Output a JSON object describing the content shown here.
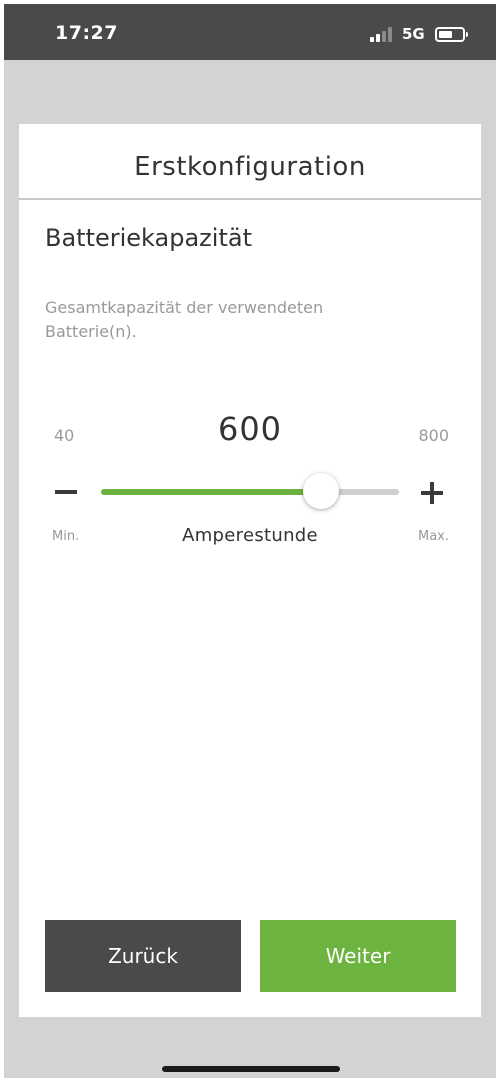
{
  "status_bar": {
    "time": "17:27",
    "network": "5G",
    "icons": [
      "signal-icon",
      "battery-icon"
    ]
  },
  "dialog": {
    "title": "Erstkonfiguration",
    "section_title": "Batteriekapazität",
    "description": "Gesamtkapazität der verwendeten Batterie(n).",
    "slider": {
      "min": "40",
      "max": "800",
      "value": "600",
      "value_number": 600,
      "min_number": 40,
      "max_number": 800,
      "min_label": "Min.",
      "max_label": "Max.",
      "unit": "Amperestunde",
      "decrement_icon": "minus-icon",
      "increment_icon": "plus-icon"
    },
    "buttons": {
      "back": "Zurück",
      "next": "Weiter"
    }
  },
  "colors": {
    "accent": "#6db33f",
    "dark_button": "#4a4a4a",
    "status_bar": "#4a4a4a",
    "background": "#d3d3d3"
  }
}
